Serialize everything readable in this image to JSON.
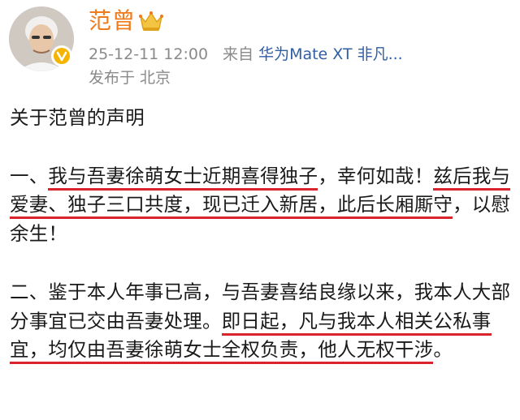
{
  "header": {
    "user_name": "范曾",
    "crown_icon": "crown-icon",
    "avatar_icon": "user-avatar",
    "vip_icon": "vip-badge-icon",
    "time": "25-12-11 12:00",
    "source_prefix": "来自",
    "device": "华为Mate XT 非凡...",
    "location_prefix": "发布于",
    "location": "北京"
  },
  "post": {
    "title": "关于范曾的声明",
    "p1": {
      "s1": "一、",
      "s2": "我与吾妻徐萌女士近期喜得独子",
      "s3": "，幸何如哉！",
      "s4": "兹后我与爱妻、独子三口共度，现已迁入新居，此后长厢厮守",
      "s5": "，以慰余生！"
    },
    "p2": {
      "s1": "二、鉴于本人年事已高，与吾妻喜结良缘以来，我本人大部分事宜已交由吾妻处理。",
      "s2": "即日起，凡与我本人相关公私事宜，均仅由吾妻徐萌女士全权负责，他人无权干涉",
      "s3": "。"
    }
  },
  "colors": {
    "name": "#f07a1a",
    "meta": "#8a8a8a",
    "device_link": "#2f5ea3",
    "highlight_underline": "#d9232d",
    "text": "#1a1a1a"
  }
}
